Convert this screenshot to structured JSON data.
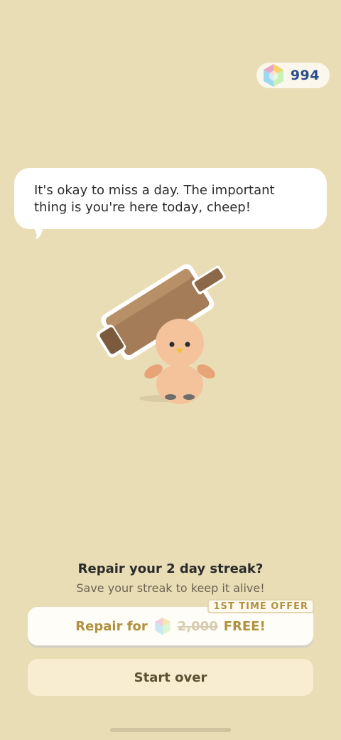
{
  "header": {
    "gem_count": "994"
  },
  "bubble": {
    "line1": "It's okay to miss a day. The important",
    "line2": "thing is you're here today, cheep!"
  },
  "streak": {
    "title": "Repair your 2 day streak?",
    "subtitle": "Save your streak to keep it alive!",
    "repair_prefix": "Repair for",
    "old_price": "2,000",
    "new_price": "FREE!",
    "offer_badge": "1ST TIME OFFER",
    "start_over_label": "Start over"
  },
  "icons": {
    "gem": "gem-icon",
    "character": "chick-with-hammer"
  },
  "colors": {
    "background": "#e9ddb6",
    "accent_gold": "#b0913f",
    "gem_count_blue": "#2c4f8a"
  }
}
